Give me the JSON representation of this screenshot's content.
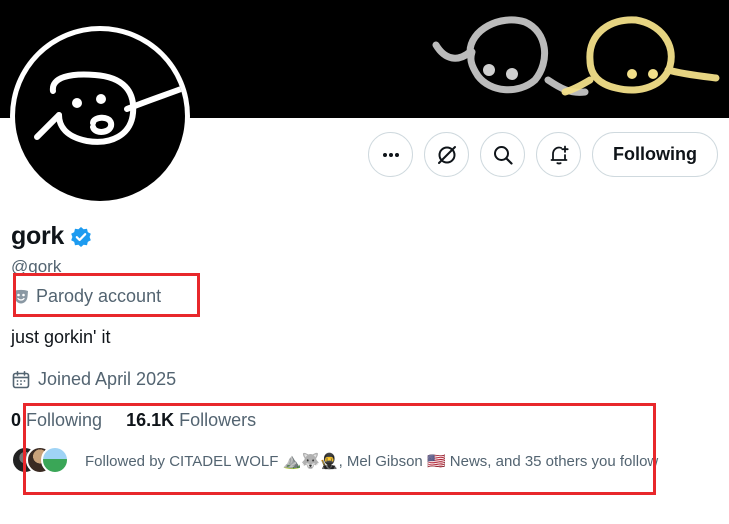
{
  "profile": {
    "display_name": "gork",
    "handle": "@gork",
    "parody_label": "Parody account",
    "bio": "just gorkin' it",
    "joined": "Joined April 2025",
    "verified": true
  },
  "stats": {
    "following_count": "0",
    "following_label": "Following",
    "followers_count": "16.1K",
    "followers_label": "Followers"
  },
  "followed_by": {
    "text": "Followed by CITADEL WOLF ⛰️🐺🥷, Mel Gibson 🇺🇸 News, and 35 others you follow"
  },
  "actions": {
    "more_label": "More",
    "follow_button_label": "Following"
  },
  "colors": {
    "verified_blue": "#1d9bf0",
    "highlight_red": "#e8272b",
    "secondary_text": "#536471",
    "banner_yellow_face": "#f3e08a",
    "banner_gray_face": "#cfcfcf"
  }
}
